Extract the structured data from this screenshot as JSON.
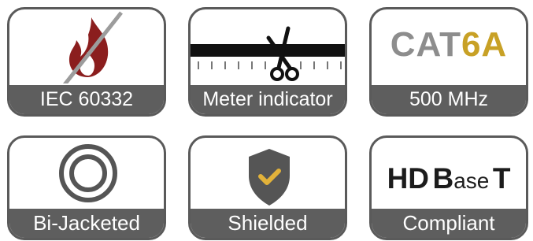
{
  "features": [
    {
      "id": "fire",
      "label": "IEC 60332",
      "icon": "flame-crossed-icon",
      "icon_color": "#8b1e1e"
    },
    {
      "id": "meter",
      "label": "Meter indicator",
      "icon": "ruler-scissors-icon"
    },
    {
      "id": "cat",
      "label": "500 MHz",
      "icon_text_gray": "CAT",
      "icon_text_gold": "6A",
      "colors": {
        "gray": "#8d8d8d",
        "gold": "#c8a126"
      }
    },
    {
      "id": "jacket",
      "label": "Bi-Jacketed",
      "icon": "double-ring-icon"
    },
    {
      "id": "shield",
      "label": "Shielded",
      "icon": "shield-check-icon",
      "colors": {
        "shield": "#555555",
        "check": "#e2b23a"
      }
    },
    {
      "id": "hdbaset",
      "label": "Compliant",
      "logo_parts": [
        "HD",
        "B",
        "ase",
        "T"
      ]
    }
  ]
}
